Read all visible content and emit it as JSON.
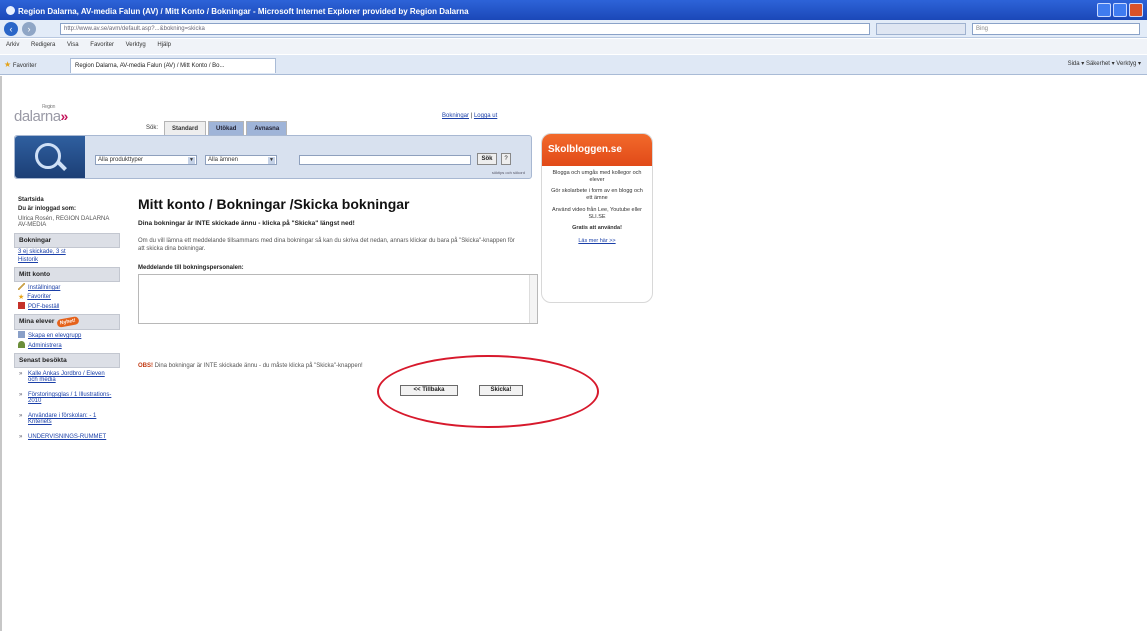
{
  "window": {
    "title": "Region Dalarna, AV-media Falun (AV) / Mitt Konto / Bokningar - Microsoft Internet Explorer provided by Region Dalarna",
    "address": "http://www.av.se/avm/default.asp?...&bokning=skicka",
    "search_placeholder": "Bing",
    "menu": [
      "Arkiv",
      "Redigera",
      "Visa",
      "Favoriter",
      "Verktyg",
      "Hjälp"
    ],
    "favorites_label": "Favoriter",
    "tab_title": "Region Dalarna, AV-media Falun (AV) / Mitt Konto / Bo...",
    "commandbar": "Sida ▾   Säkerhet ▾   Verktyg ▾"
  },
  "site": {
    "logo_text": "dalarna",
    "logo_sup": "Region",
    "tabs": [
      "Sök:",
      "Standard",
      "Utökad",
      "Avnasna"
    ],
    "top_links": [
      "Bokningar",
      "Logga ut"
    ],
    "search": {
      "select1": "Alla produkttyper",
      "select2": "Alla ämnen",
      "button": "Sök",
      "help": "?",
      "advanced": "söktips och sökord"
    }
  },
  "sidebar": {
    "startsida": "Startsida",
    "logged_in": "Du är inloggad som:",
    "user": "Ulrica Rosén, REGION DALARNA AV-MEDIA",
    "bokningar_head": "Bokningar",
    "bokningar_links": [
      "3 ej skickade, 3 st",
      "Historik"
    ],
    "konto_head": "Mitt konto",
    "konto_links": [
      "Inställningar",
      "Favoriter",
      "PDF-beställ"
    ],
    "elever_head": "Mina elever",
    "nyhet": "Nyhet!",
    "elever_links": [
      "Skapa en elevgrupp",
      "Administrera"
    ],
    "senast_head": "Senast besökta",
    "history": [
      "Kalle Ankas Jordbro / Eleven och media",
      "Förstoringsglas / 1 Illustrations- 2010",
      "Användare i förskolan: - 1 Kriteriets",
      "UNDERVISNINGS-RUMMET"
    ]
  },
  "main": {
    "heading": "Mitt konto / Bokningar /Skicka bokningar",
    "subheading": "Dina bokningar är INTE skickade ännu - klicka på \"Skicka\" längst ned!",
    "paragraph": "Om du vill lämna ett meddelande tillsammans med dina bokningar så kan du skriva det nedan, annars klickar du bara på \"Skicka\"-knappen för att skicka dina bokningar.",
    "message_label": "Meddelande till bokningspersonalen:",
    "obs_label": "OBS!",
    "obs_text": "Dina bokningar är INTE skickade ännu - du måste klicka på \"Skicka\"-knappen!",
    "back_button": "<< Tillbaka",
    "send_button": "Skicka!"
  },
  "ad": {
    "banner": "Skolbloggen.se",
    "line1": "Blogga och umgås med kollegor och elever",
    "line2": "Gör skolarbete i form av en blogg och ett ämne",
    "line3": "Använd video från Lee, Youtube eller SLI.SE",
    "line4": "Gratis att använda!",
    "link": "Läs mer här >>"
  }
}
